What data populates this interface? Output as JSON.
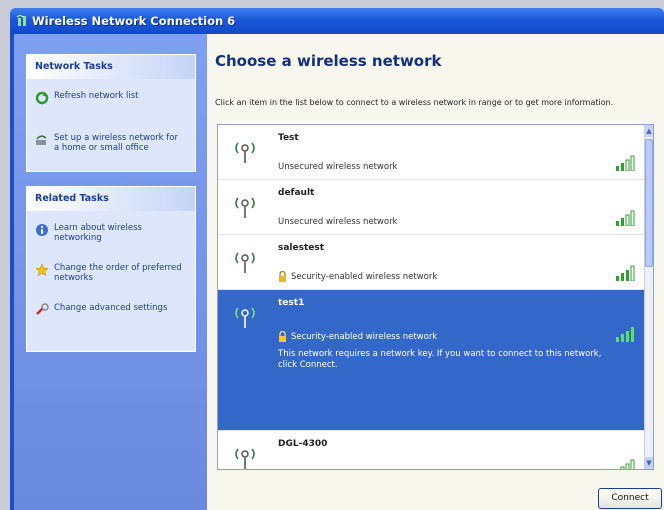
{
  "window": {
    "title": "Wireless Network Connection 6"
  },
  "network_tasks": {
    "header": "Network Tasks",
    "items": [
      {
        "label": "Refresh network list",
        "icon": "refresh-icon"
      },
      {
        "label": "Set up a wireless network for a home or small office",
        "icon": "setup-network-icon"
      }
    ]
  },
  "related_tasks": {
    "header": "Related Tasks",
    "items": [
      {
        "label": "Learn about wireless networking",
        "icon": "info-icon"
      },
      {
        "label": "Change the order of preferred networks",
        "icon": "star-icon"
      },
      {
        "label": "Change advanced settings",
        "icon": "settings-icon"
      }
    ]
  },
  "main": {
    "heading": "Choose a wireless network",
    "instructions": "Click an item in the list below to connect to a wireless network in range or to get more information."
  },
  "networks": [
    {
      "ssid": "Test",
      "status": "Unsecured wireless network",
      "secured": false,
      "selected": false
    },
    {
      "ssid": "default",
      "status": "Unsecured wireless network",
      "secured": false,
      "selected": false
    },
    {
      "ssid": "salestest",
      "status": "Security-enabled wireless network",
      "secured": true,
      "selected": false
    },
    {
      "ssid": "test1",
      "status": "Security-enabled wireless network",
      "secured": true,
      "selected": true,
      "message": "This network requires a network key. If you want to connect to this network, click Connect."
    },
    {
      "ssid": "DGL-4300",
      "status": "",
      "secured": false,
      "selected": false
    }
  ],
  "buttons": {
    "connect": "Connect"
  },
  "colors": {
    "selection": "#3367c8",
    "titlebar": "#1f4fc8",
    "taskpane": "#7f9ff0"
  }
}
